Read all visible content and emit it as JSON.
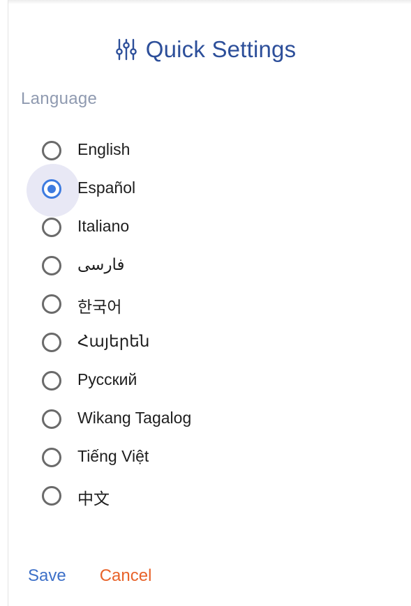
{
  "header": {
    "title": "Quick Settings",
    "icon": "sliders-icon"
  },
  "language": {
    "label": "Language",
    "selected": "Español",
    "options": [
      {
        "label": "English",
        "checked": false
      },
      {
        "label": "Español",
        "checked": true
      },
      {
        "label": "Italiano",
        "checked": false
      },
      {
        "label": "فارسی",
        "checked": false
      },
      {
        "label": "한국어",
        "checked": false
      },
      {
        "label": "Հայերեն",
        "checked": false
      },
      {
        "label": "Русский",
        "checked": false
      },
      {
        "label": "Wikang Tagalog",
        "checked": false
      },
      {
        "label": "Tiếng Việt",
        "checked": false
      },
      {
        "label": "中文",
        "checked": false
      }
    ]
  },
  "actions": {
    "save_label": "Save",
    "cancel_label": "Cancel"
  },
  "colors": {
    "title": "#2d4f9a",
    "section_label": "#8f9ab0",
    "radio_checked": "#3d7be0",
    "radio_unchecked": "#6a6a6a",
    "save": "#3d70c8",
    "cancel": "#e8632a"
  }
}
